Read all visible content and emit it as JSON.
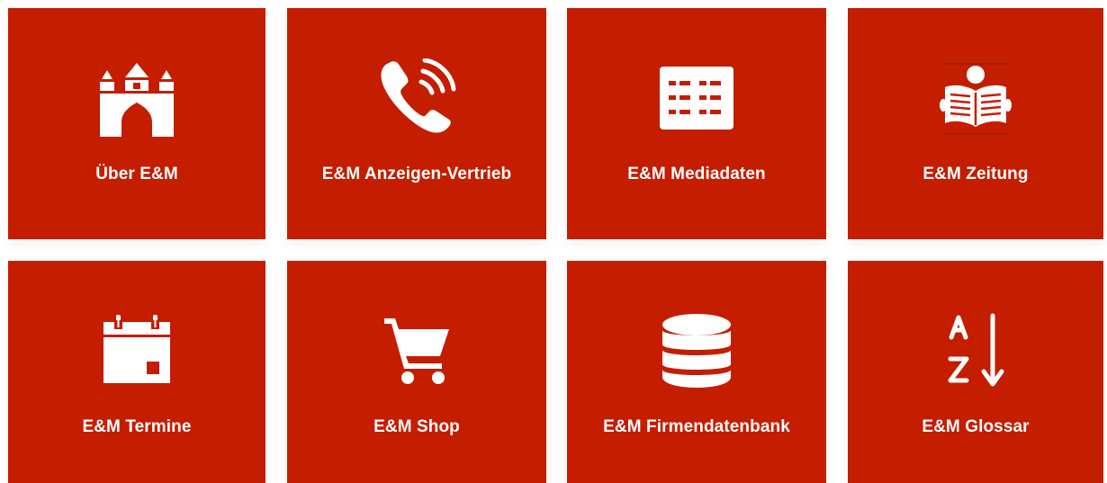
{
  "tiles": [
    {
      "label": "Über E&M",
      "icon": "castle-icon"
    },
    {
      "label": "E&M Anzeigen-Vertrieb",
      "icon": "phone-icon"
    },
    {
      "label": "E&M Mediadaten",
      "icon": "list-table-icon"
    },
    {
      "label": "E&M Zeitung",
      "icon": "newspaper-reader-icon"
    },
    {
      "label": "E&M Termine",
      "icon": "calendar-icon"
    },
    {
      "label": "E&M Shop",
      "icon": "shopping-cart-icon"
    },
    {
      "label": "E&M Firmendatenbank",
      "icon": "database-icon"
    },
    {
      "label": "E&M Glossar",
      "icon": "sort-alpha-icon"
    }
  ],
  "colors": {
    "tile_background": "#c41d00",
    "text": "#ffffff"
  }
}
